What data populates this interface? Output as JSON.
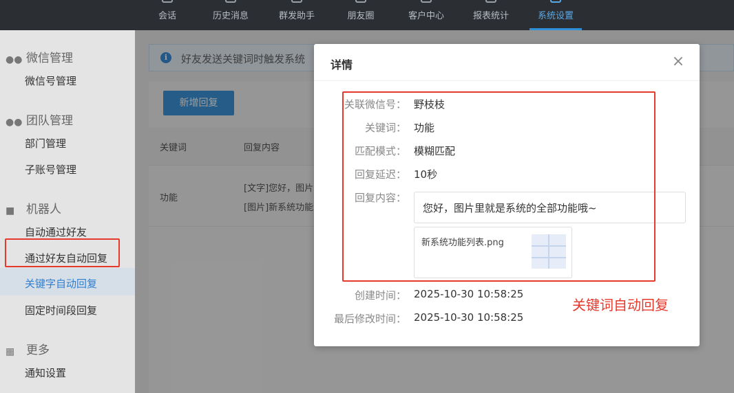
{
  "topnav": {
    "items": [
      {
        "label": "会话"
      },
      {
        "label": "历史消息"
      },
      {
        "label": "群发助手"
      },
      {
        "label": "朋友圈"
      },
      {
        "label": "客户中心"
      },
      {
        "label": "报表统计"
      },
      {
        "label": "系统设置",
        "active": true
      }
    ]
  },
  "sidebar": {
    "sections": [
      {
        "title": "微信管理",
        "icon": "wechat-icon",
        "items": [
          "微信号管理"
        ]
      },
      {
        "title": "团队管理",
        "icon": "team-icon",
        "items": [
          "部门管理",
          "子账号管理"
        ]
      },
      {
        "title": "机器人",
        "icon": "robot-icon",
        "items": [
          "自动通过好友",
          "通过好友自动回复",
          "关键字自动回复",
          "固定时间段回复"
        ]
      },
      {
        "title": "更多",
        "icon": "grid-icon",
        "items": [
          "通知设置"
        ]
      }
    ],
    "active_item": "关键字自动回复"
  },
  "banner": {
    "text": "好友发送关键词时触发系统"
  },
  "panel": {
    "add_button": "新增回复",
    "columns": [
      "关键词",
      "回复内容"
    ],
    "row": {
      "keyword": "功能",
      "content_line1": "[文字]您好，图片",
      "content_line2": "[图片]新系统功能"
    }
  },
  "modal": {
    "title": "详情",
    "close": "×",
    "fields": {
      "wechat_label": "关联微信号：",
      "wechat_value": "野枝枝",
      "keyword_label": "关键词：",
      "keyword_value": "功能",
      "match_label": "匹配模式：",
      "match_value": "模糊匹配",
      "delay_label": "回复延迟：",
      "delay_value": "10秒",
      "content_label": "回复内容：",
      "content_text": "您好，图片里就是系统的全部功能哦~",
      "image_name": "新系统功能列表.png",
      "created_label": "创建时间：",
      "created_value": "2025-10-30 10:58:25",
      "modified_label": "最后修改时间：",
      "modified_value": "2025-10-30 10:58:25"
    }
  },
  "annotation": {
    "text": "关键词自动回复",
    "color": "#e5392c"
  },
  "colors": {
    "accent": "#2f8fd8",
    "nav_bg": "#2b2e33",
    "highlight": "#e5392c"
  }
}
